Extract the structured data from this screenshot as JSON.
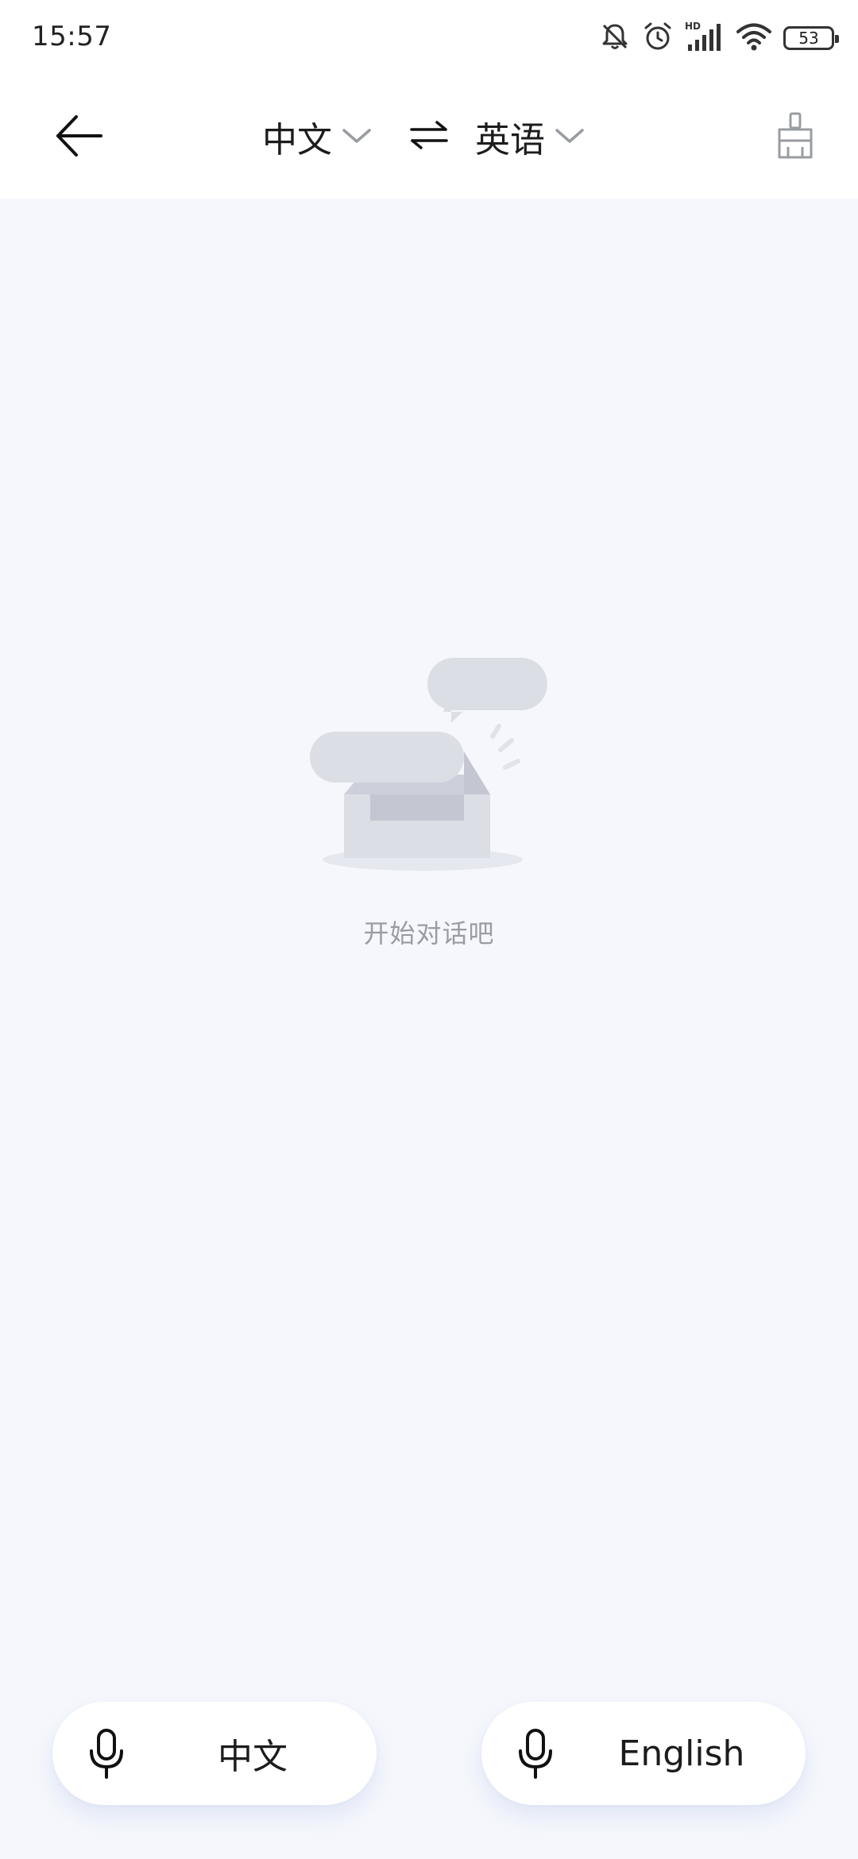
{
  "status_bar": {
    "time": "15:57",
    "battery": "53",
    "icons": [
      "bell-off-icon",
      "alarm-icon",
      "hd-signal-icon",
      "wifi-icon",
      "battery-icon"
    ]
  },
  "header": {
    "back_icon": "back-arrow-icon",
    "source_language": "中文",
    "target_language": "英语",
    "swap_icon": "swap-arrows-icon",
    "clear_icon": "broom-icon"
  },
  "empty_state": {
    "illustration": "empty-inbox-chat-icon",
    "message": "开始对话吧"
  },
  "bottom_buttons": {
    "left": {
      "label": "中文",
      "icon": "microphone-icon"
    },
    "right": {
      "label": "English",
      "icon": "microphone-icon"
    }
  },
  "colors": {
    "background": "#f5f7fc",
    "surface": "#ffffff",
    "text": "#1c1c1c",
    "muted": "#9a9ca3",
    "illustration": "#dcdee6"
  }
}
